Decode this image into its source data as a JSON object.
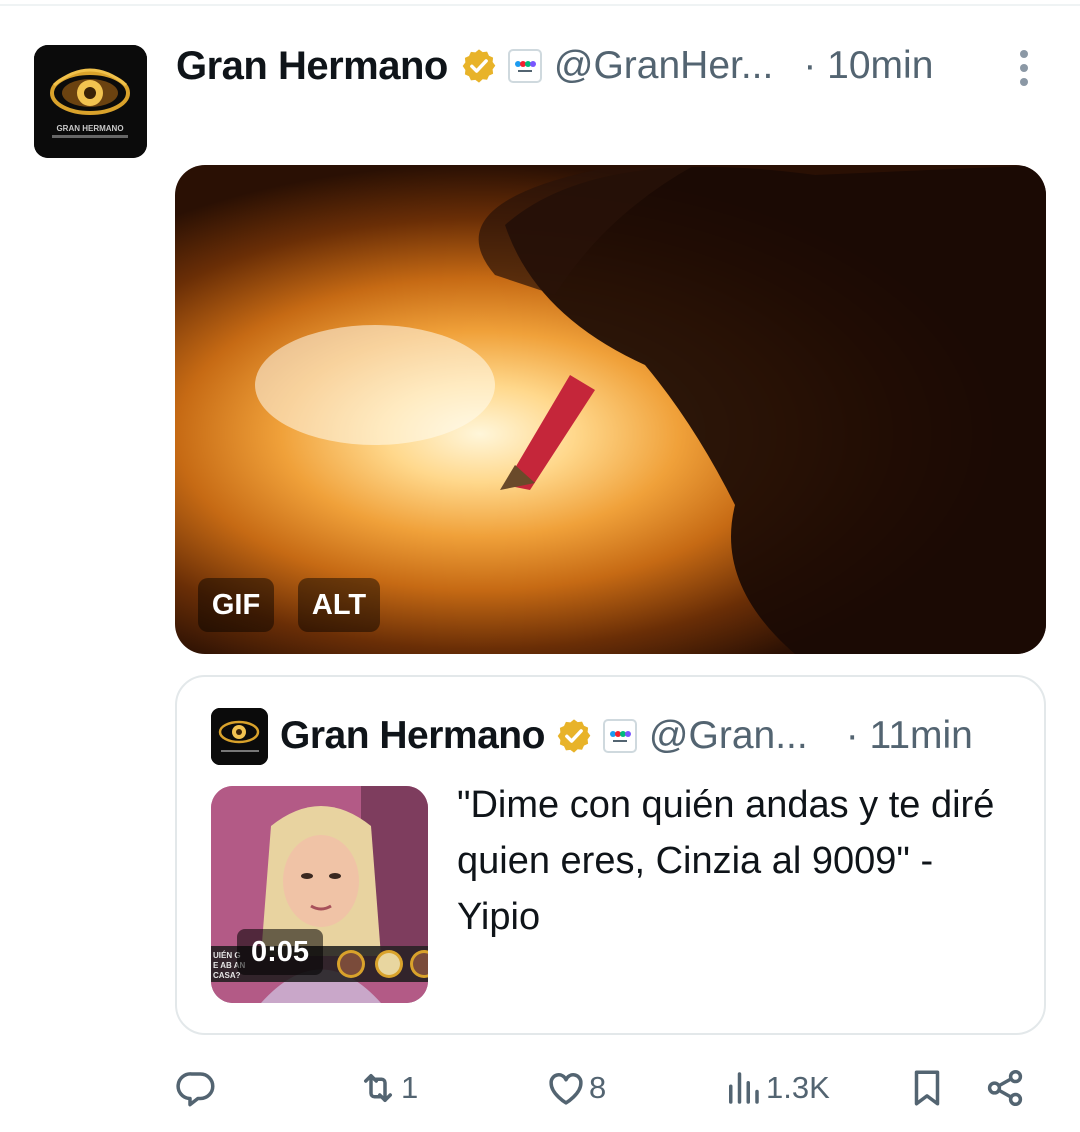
{
  "tweet": {
    "author_name": "Gran Hermano",
    "handle": "@GranHer...",
    "time": "· 10min",
    "avatar_logo_text": "GRAN HERMANO",
    "media": {
      "badge_gif": "GIF",
      "badge_alt": "ALT"
    }
  },
  "quoted_tweet": {
    "author_name": "Gran Hermano",
    "handle": "@Gran...",
    "time": "· 11min",
    "text": "\"Dime con quién andas y te diré quien eres, Cinzia al 9009\" - Yipio",
    "video_duration": "0:05",
    "thumb_overlay_text": "UIÉN G\nE AB AN\nCASA?"
  },
  "actions": {
    "reply_count": "",
    "retweet_count": "1",
    "like_count": "8",
    "views_count": "1.3K"
  },
  "colors": {
    "text_primary": "#0f1419",
    "text_secondary": "#536471",
    "verified_gold": "#e8b329",
    "border": "#e3e8ea"
  },
  "icons": {
    "verified": "verified-gold-badge-icon",
    "affiliate": "telefe-affiliate-icon",
    "more": "more-vertical-icon",
    "reply": "reply-icon",
    "retweet": "retweet-icon",
    "like": "heart-icon",
    "views": "views-bar-icon",
    "bookmark": "bookmark-icon",
    "share": "share-icon"
  }
}
